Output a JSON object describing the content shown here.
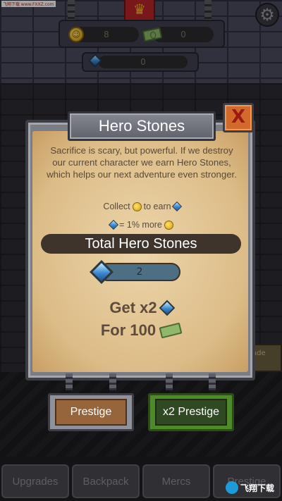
{
  "header": {
    "coins": "8",
    "cash": "0",
    "hero_stones": "0",
    "settings_icon": "gear-icon",
    "site_watermark": "飞翔下载 www.FXXZ.com"
  },
  "modal": {
    "title": "Hero Stones",
    "close_label": "X",
    "description": "Sacrifice is scary, but powerful. If we destroy our current character we earn Hero Stones, which helps our next adventure even stronger.",
    "collect_prefix": "Collect",
    "collect_suffix": "to earn",
    "ratio_suffix": "= 1% more",
    "total_label": "Total Hero Stones",
    "total_value": "2",
    "get_label": "Get x2",
    "cost_label": "For 100",
    "prestige_label": "Prestige",
    "x2_prestige_label": "x2 Prestige"
  },
  "side_button_label": "ade",
  "nav": {
    "tabs": [
      "Upgrades",
      "Backpack",
      "Mercs",
      "Prestige"
    ]
  },
  "watermark": "飞翔下载",
  "colors": {
    "parchment": "#dcbc87",
    "close_button": "#d36a2d",
    "prestige_button": "#96653b",
    "x2_button": "#2f4a22"
  }
}
